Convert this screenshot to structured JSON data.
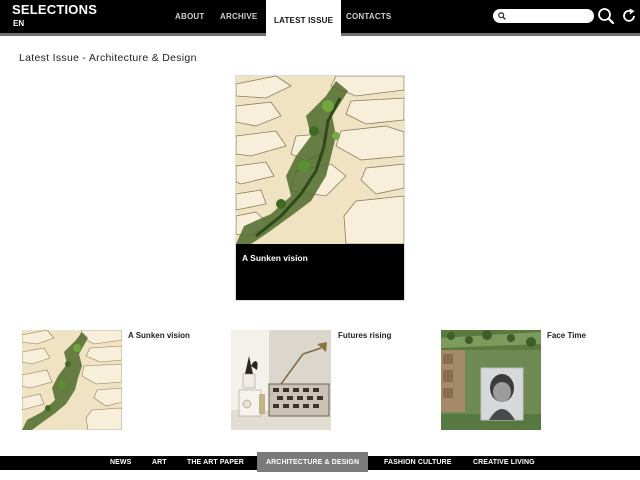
{
  "header": {
    "brand": "SELECTIONS",
    "language": "EN",
    "nav": [
      {
        "label": "ABOUT"
      },
      {
        "label": "ARCHIVE"
      },
      {
        "label": "LATEST ISSUE",
        "active": true
      },
      {
        "label": "CONTACTS"
      }
    ],
    "search_value": "",
    "icons": [
      "search-icon",
      "magnifier-icon",
      "refresh-icon"
    ]
  },
  "main": {
    "page_title": "Latest Issue - Architecture & Design",
    "hero": {
      "title": "A Sunken vision"
    },
    "articles": [
      {
        "title": "A Sunken vision"
      },
      {
        "title": "Futures rising"
      },
      {
        "title": "Face Time"
      }
    ]
  },
  "footer": {
    "categories": [
      {
        "label": "NEWS"
      },
      {
        "label": "ART"
      },
      {
        "label": "THE ART PAPER"
      },
      {
        "label": "ARCHITECTURE & DESIGN",
        "active": true
      },
      {
        "label": "FASHION CULTURE"
      },
      {
        "label": "CREATIVE LIVING"
      }
    ]
  },
  "colors": {
    "bar": "#000000",
    "active_footer": "#7a7a7a",
    "background": "#ffffff"
  }
}
